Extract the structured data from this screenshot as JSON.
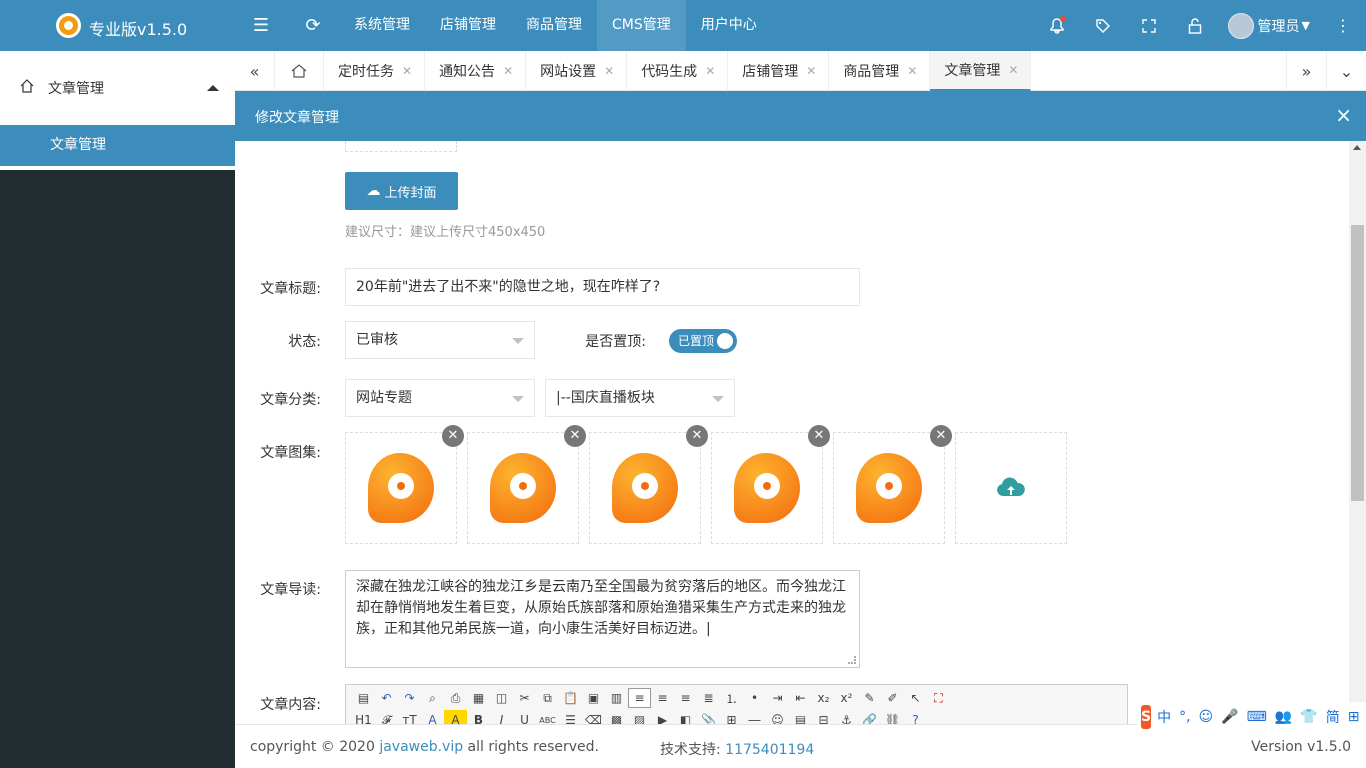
{
  "app": {
    "title": "专业版v1.5.0"
  },
  "topnav": {
    "items": [
      "系统管理",
      "店铺管理",
      "商品管理",
      "CMS管理",
      "用户中心"
    ],
    "active": "CMS管理"
  },
  "user": {
    "name": "管理员"
  },
  "sidebar": {
    "group": "文章管理",
    "item": "文章管理"
  },
  "tabs": {
    "items": [
      "定时任务",
      "通知公告",
      "网站设置",
      "代码生成",
      "店铺管理",
      "商品管理",
      "文章管理"
    ],
    "active": "文章管理"
  },
  "modal": {
    "title": "修改文章管理"
  },
  "form": {
    "upload_label": "上传封面",
    "cover_hint": "建议尺寸：建议上传尺寸450x450",
    "title_label": "文章标题:",
    "title_value": "20年前\"进去了出不来\"的隐世之地，现在咋样了?",
    "status_label": "状态:",
    "status_value": "已审核",
    "top_label": "是否置顶:",
    "top_value": "已置顶",
    "category_label": "文章分类:",
    "category_value": "网站专题",
    "subcategory_value": "|--国庆直播板块",
    "gallery_label": "文章图集:",
    "gallery_count": 5,
    "intro_label": "文章导读:",
    "intro_value": "深藏在独龙江峡谷的独龙江乡是云南乃至全国最为贫穷落后的地区。而今独龙江却在静悄悄地发生着巨变，从原始氏族部落和原始渔猎采集生产方式走来的独龙族，正和其他兄弟民族一道，向小康生活美好目标迈进。",
    "content_label": "文章内容:"
  },
  "footer": {
    "copyright_prefix": "copyright © 2020 ",
    "copyright_link": "javaweb.vip",
    "copyright_suffix": " all rights reserved.",
    "support_label": "技术支持: ",
    "support_value": "1175401194",
    "version": "Version v1.5.0"
  },
  "ime": {
    "items": [
      "中",
      "°,",
      "☺",
      "🎤",
      "⌨",
      "👥",
      "👕",
      "简",
      "⊞"
    ]
  },
  "colors": {
    "primary": "#3c8dbc",
    "sidebar": "#222d32",
    "accent": "#f5901f"
  }
}
